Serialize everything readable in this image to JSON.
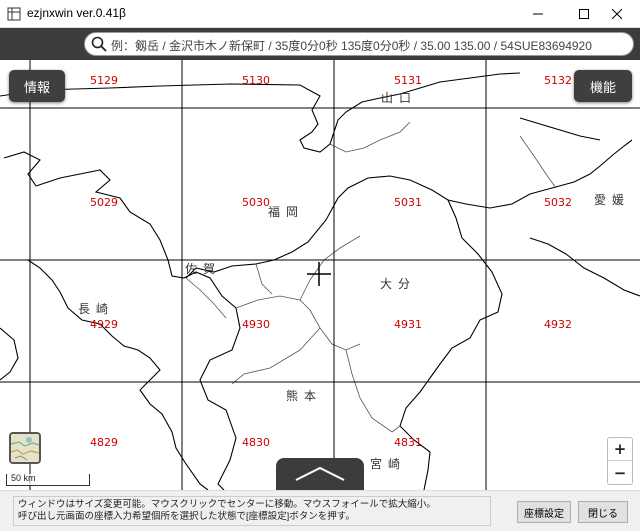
{
  "window": {
    "title": "ezjnxwin ver.0.41β"
  },
  "search": {
    "placeholder": "例：剱岳 / 金沢市木ノ新保町 / 35度0分0秒 135度0分0秒 / 35.00 135.00 / 54SUE83694920"
  },
  "buttons": {
    "info": "情報",
    "function": "機能",
    "coord_setting": "座標設定",
    "close": "閉じる",
    "zoom_in": "+",
    "zoom_out": "−"
  },
  "scale": {
    "label": "50 km"
  },
  "map": {
    "mesh_labels": [
      "5129",
      "5130",
      "5131",
      "5132",
      "5029",
      "5030",
      "5031",
      "5032",
      "4929",
      "4930",
      "4931",
      "4932",
      "4829",
      "4830",
      "4831"
    ],
    "place_labels": [
      "山口",
      "福岡",
      "愛媛",
      "佐賀",
      "大分",
      "長崎",
      "熊本",
      "宮崎"
    ]
  },
  "status": {
    "line1": "ウィンドウはサイズ変更可能。マウスクリックでセンターに移動。マウスフォイールで拡大縮小。",
    "line2": "呼び出し元画面の座標入力希望個所を選択した状態で[座標設定]ボタンを押す。"
  },
  "colors": {
    "mesh_label": "#cc0000",
    "grid": "#000000",
    "coast": "#000000",
    "pref_border": "#555555",
    "toolbar": "#3c3c3c"
  }
}
